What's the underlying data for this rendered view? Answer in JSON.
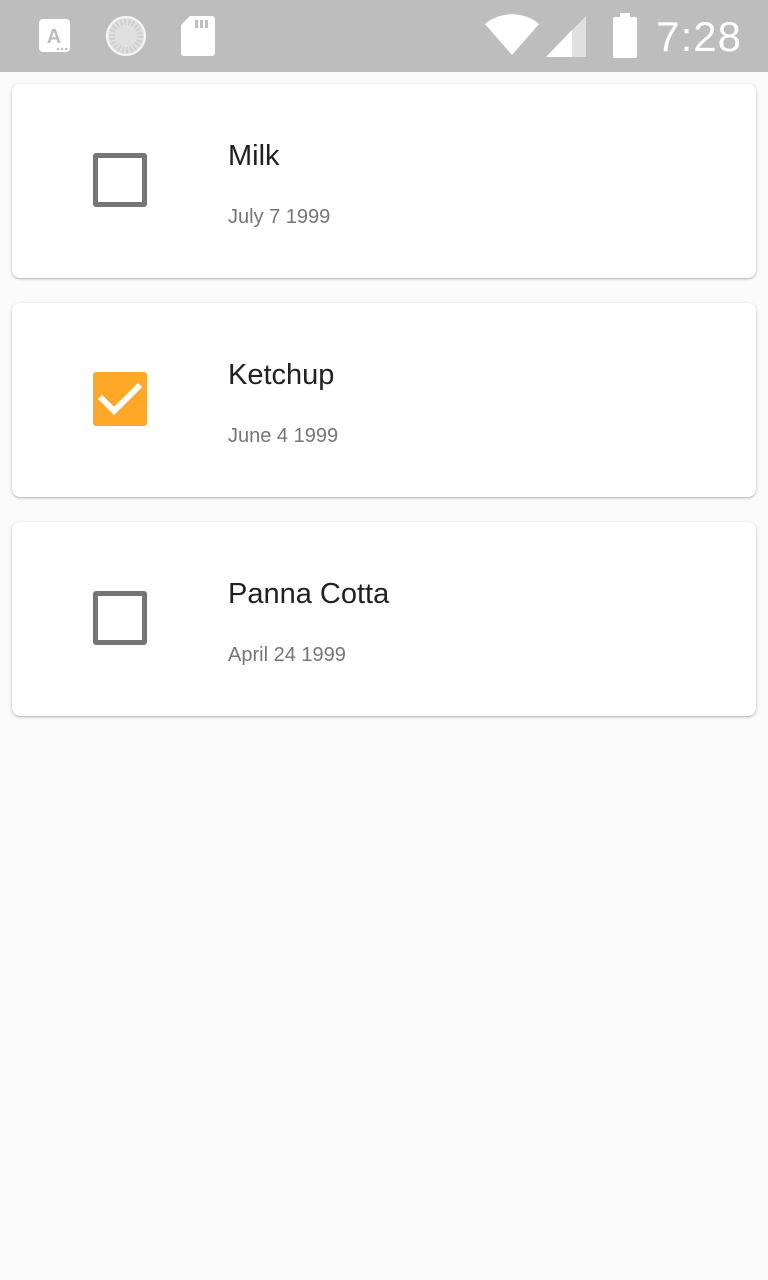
{
  "status_bar": {
    "time": "7:28",
    "icons": [
      "font-a-icon",
      "sync-spinner-icon",
      "sd-card-icon",
      "wifi-icon",
      "cell-signal-icon",
      "battery-icon"
    ],
    "color": "#bdbdbd"
  },
  "items": [
    {
      "title": "Milk",
      "date": "July 7 1999",
      "checked": false
    },
    {
      "title": "Ketchup",
      "date": "June 4 1999",
      "checked": true
    },
    {
      "title": "Panna Cotta",
      "date": "April 24 1999",
      "checked": false
    }
  ],
  "colors": {
    "accent": "#ffa726",
    "checkbox_border": "#757575",
    "title": "#212121",
    "subtitle": "#757575",
    "background": "#fafafa"
  }
}
